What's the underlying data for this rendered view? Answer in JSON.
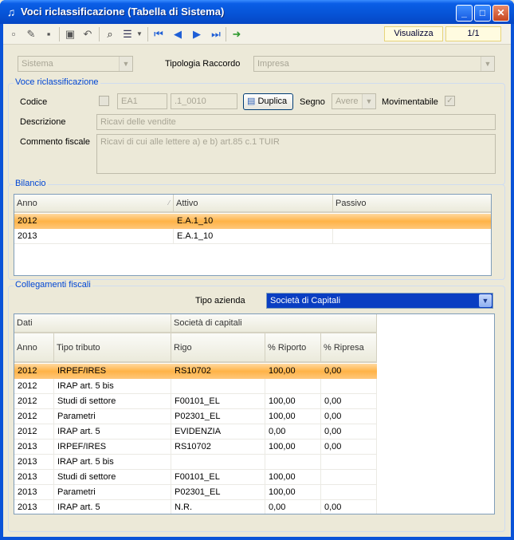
{
  "window": {
    "title": "Voci riclassificazione (Tabella di Sistema)",
    "controls": {
      "minimize": "_",
      "maximize": "□",
      "close": "✕"
    }
  },
  "toolbar": {
    "icons": [
      "new-icon",
      "edit-icon",
      "delete-icon",
      "save-icon",
      "undo-icon",
      "find-icon",
      "grid-view-icon",
      "dropdown-arrow-icon",
      "first-record-icon",
      "prev-record-icon",
      "next-record-icon",
      "last-record-icon",
      "export-icon"
    ],
    "mode": "Visualizza",
    "record_position": "1/1"
  },
  "top": {
    "source_value": "Sistema",
    "tipologia_label": "Tipologia Raccordo",
    "tipologia_value": "Impresa"
  },
  "voce": {
    "title": "Voce riclassificazione",
    "codice_label": "Codice",
    "codice_value": "EA1",
    "codice_suffix": ".1_0010",
    "duplica_label": "Duplica",
    "segno_label": "Segno",
    "segno_value": "Avere",
    "movimentabile_label": "Movimentabile",
    "movimentabile_checked": true,
    "descrizione_label": "Descrizione",
    "descrizione_value": "Ricavi delle vendite",
    "commento_label": "Commento fiscale",
    "commento_value": "Ricavi di cui alle lettere a) e b) art.85 c.1 TUIR"
  },
  "bilancio": {
    "title": "Bilancio",
    "columns": [
      "Anno",
      "Attivo",
      "Passivo"
    ],
    "rows": [
      {
        "anno": "2012",
        "attivo": "E.A.1_10",
        "passivo": "",
        "selected": true
      },
      {
        "anno": "2013",
        "attivo": "E.A.1_10",
        "passivo": "",
        "selected": false
      }
    ]
  },
  "collegamenti": {
    "title": "Collegamenti fiscali",
    "tipo_azienda_label": "Tipo azienda",
    "tipo_azienda_value": "Società di Capitali",
    "group_headers": [
      "Dati",
      "Società di capitali"
    ],
    "columns": [
      "Anno",
      "Tipo tributo",
      "Rigo",
      "% Riporto",
      "% Ripresa"
    ],
    "rows": [
      [
        "2012",
        "IRPEF/IRES",
        "RS10702",
        "100,00",
        "0,00"
      ],
      [
        "2012",
        "IRAP art. 5 bis",
        "",
        "",
        ""
      ],
      [
        "2012",
        "Studi di settore",
        "F00101_EL",
        "100,00",
        "0,00"
      ],
      [
        "2012",
        "Parametri",
        "P02301_EL",
        "100,00",
        "0,00"
      ],
      [
        "2012",
        "IRAP art. 5",
        "EVIDENZIA",
        "0,00",
        "0,00"
      ],
      [
        "2013",
        "IRPEF/IRES",
        "RS10702",
        "100,00",
        "0,00"
      ],
      [
        "2013",
        "IRAP art. 5 bis",
        "",
        "",
        ""
      ],
      [
        "2013",
        "Studi di settore",
        "F00101_EL",
        "100,00",
        ""
      ],
      [
        "2013",
        "Parametri",
        "P02301_EL",
        "100,00",
        ""
      ],
      [
        "2013",
        "IRAP art. 5",
        "N.R.",
        "0,00",
        "0,00"
      ]
    ],
    "selected_row": 0
  }
}
